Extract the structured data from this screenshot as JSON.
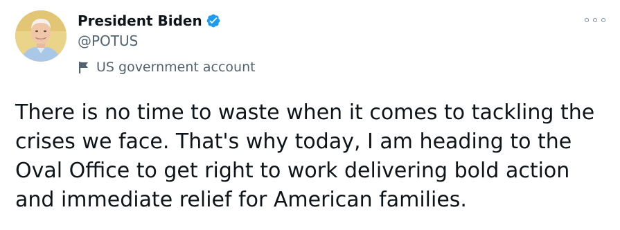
{
  "author": {
    "display_name": "President Biden",
    "handle": "@POTUS",
    "verified": true,
    "account_label": "US government account"
  },
  "tweet": {
    "lines": [
      "There is no time to waste when it comes to tackling the",
      "crises we face. That's why today, I am heading to the",
      "Oval Office to get right to work delivering bold action",
      "and immediate relief for American families."
    ]
  },
  "icons": {
    "verified": "verified-badge-icon",
    "label": "flag-icon",
    "menu": "more-options-icon"
  },
  "colors": {
    "text": "#0f1419",
    "secondary": "#536471",
    "verified_blue": "#1d9bf0",
    "avatar_bg": "#e6cf82"
  }
}
